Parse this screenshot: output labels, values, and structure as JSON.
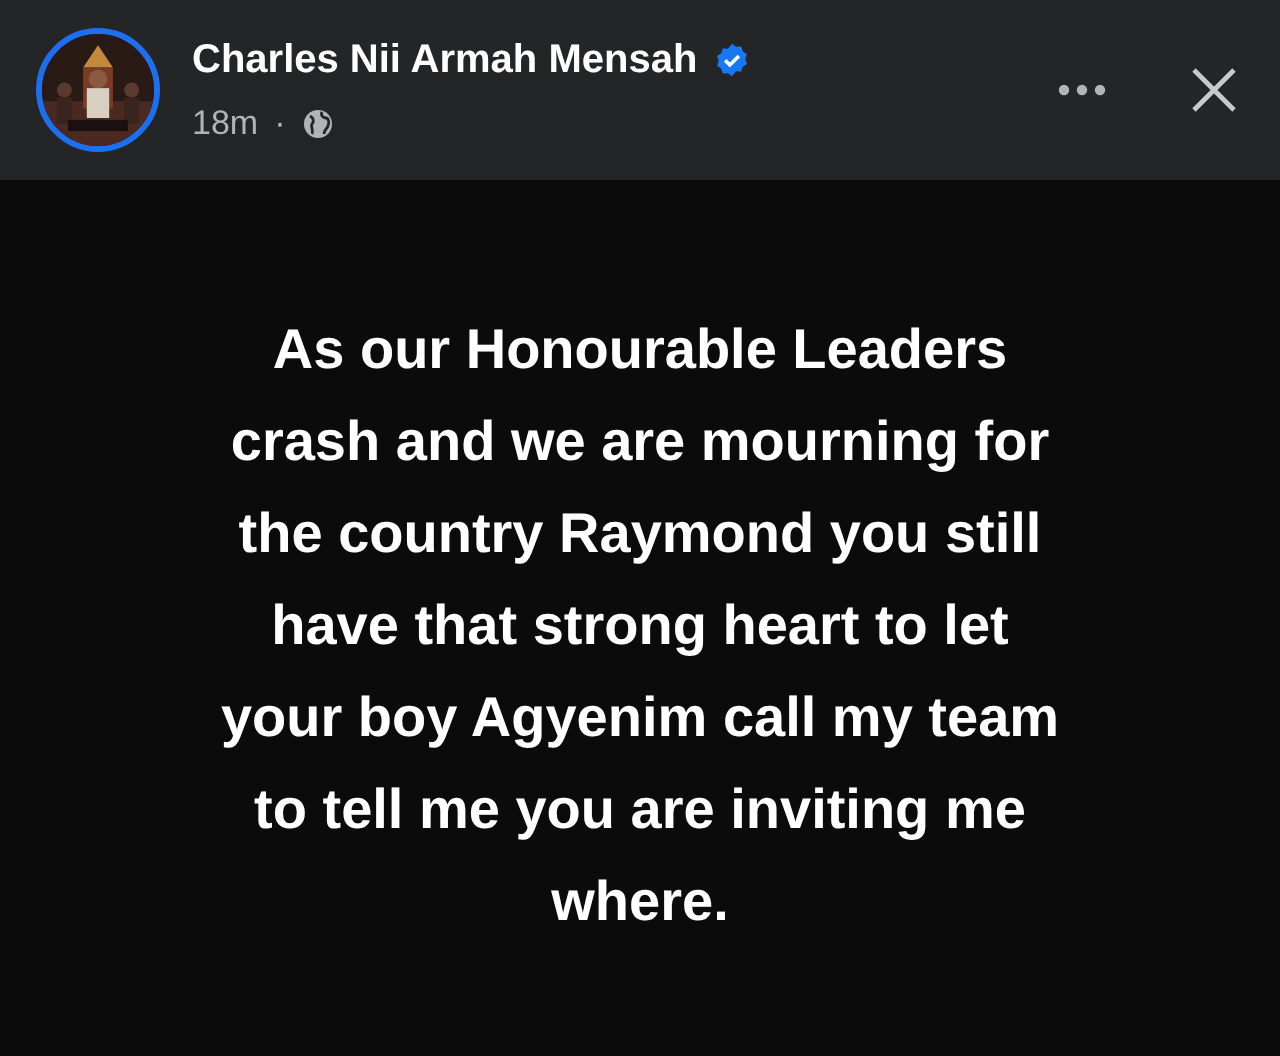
{
  "post": {
    "author": "Charles Nii Armah Mensah",
    "verified": true,
    "time": "18m",
    "separator": "·",
    "text": "As our Honourable Leaders\ncrash and we are mourning for\nthe country Raymond you still\nhave that strong heart to let\nyour boy Agyenim call my team\nto tell me you are inviting me\nwhere."
  }
}
